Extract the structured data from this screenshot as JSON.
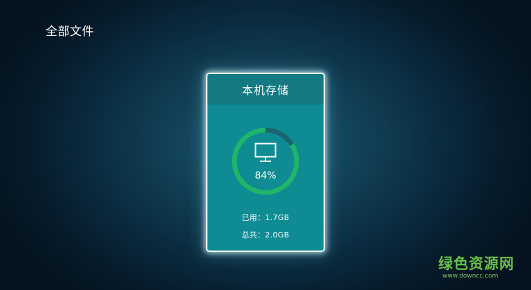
{
  "header": {
    "title": "全部文件"
  },
  "storage_card": {
    "title": "本机存储",
    "icon": "monitor-icon",
    "usage_percent_value": 84,
    "usage_percent_label": "84%",
    "used_label": "已用：",
    "used_value": "1.7GB",
    "total_label": "总共：",
    "total_value": "2.0GB"
  },
  "watermark": {
    "name": "绿色资源网",
    "url": "www.downcc.com"
  },
  "colors": {
    "background": "#0b2c40",
    "card_body": "#0f8b93",
    "card_header": "#137982",
    "card_border": "#f2fbfb",
    "ring_used": "#1fb56a",
    "ring_free": "#1a6470",
    "watermark_green": "#69c14a"
  }
}
